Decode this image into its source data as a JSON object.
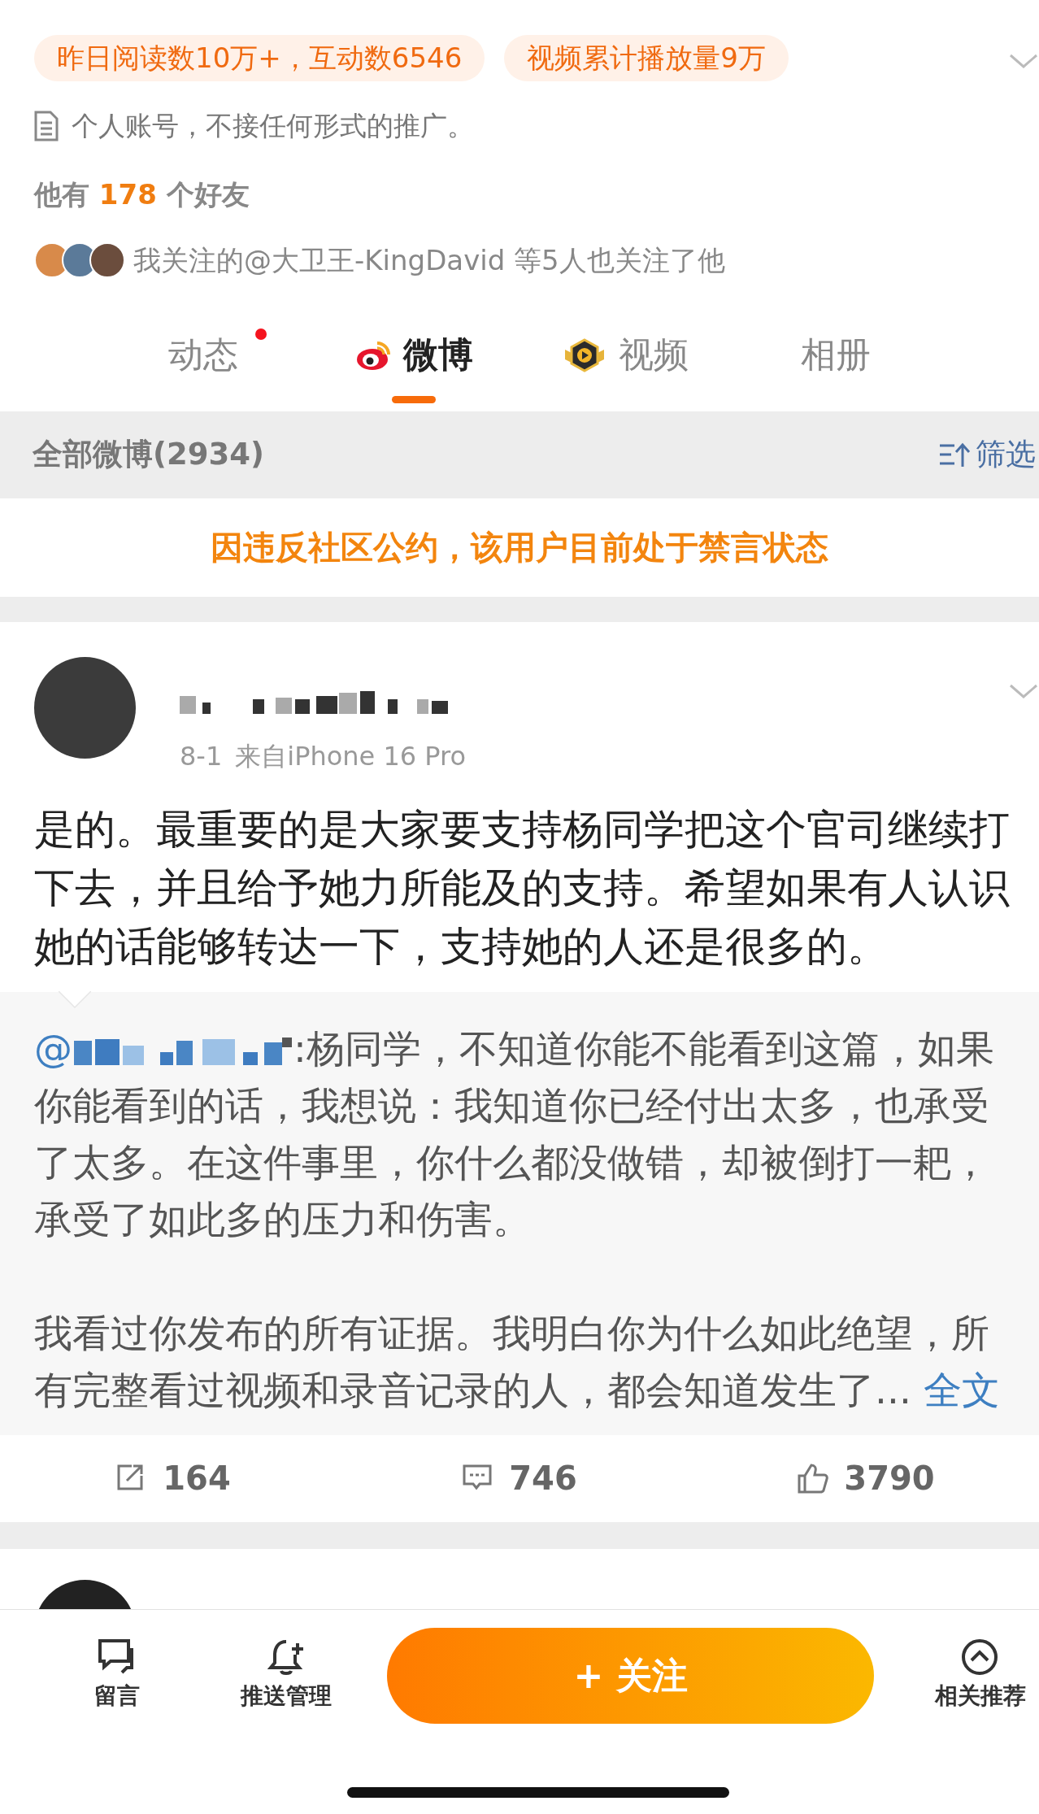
{
  "stats_chips": [
    "昨日阅读数10万+，互动数6546",
    "视频累计播放量9万"
  ],
  "bio": "个人账号，不接任何形式的推广。",
  "friends": {
    "prefix": "他有",
    "count": "178",
    "suffix": "个好友"
  },
  "mutual_follow": "我关注的@大卫王-KingDavid 等5人也关注了他",
  "tabs": [
    {
      "label": "动态",
      "selected": false,
      "unread": true,
      "kind": "plain"
    },
    {
      "label": "微博",
      "selected": true,
      "unread": false,
      "kind": "weibo"
    },
    {
      "label": "视频",
      "selected": false,
      "unread": false,
      "kind": "video"
    },
    {
      "label": "相册",
      "selected": false,
      "unread": false,
      "kind": "plain"
    }
  ],
  "feed_header": {
    "title": "全部微博(2934)",
    "filter": "筛选"
  },
  "notice": "因违反社区公约，该用户目前处于禁言状态",
  "post": {
    "date": "8-1",
    "source": "来自iPhone 16 Pro",
    "text": "是的。最重要的是大家要支持杨同学把这个官司继续打下去，并且给予她力所能及的支持。希望如果有人认识她的话能够转达一下，支持她的人还是很多的。",
    "quote": {
      "mention": "@",
      "first": ":杨同学，不知道你能不能看到这篇，如果你能看到的话，我想说：我知道你已经付出太多，也承受了太多。在这件事里，你什么都没做错，却被倒打一耙，承受了如此多的压力和伤害。",
      "second": "我看过你发布的所有证据。我明白你为什么如此绝望，所有完整看过视频和录音记录的人，都会知道发生了...",
      "more": "全文"
    },
    "actions": [
      {
        "kind": "repost",
        "count": "164"
      },
      {
        "kind": "comment",
        "count": "746"
      },
      {
        "kind": "like",
        "count": "3790"
      }
    ]
  },
  "bottom_bar": [
    {
      "kind": "message",
      "label": "留言"
    },
    {
      "kind": "bell",
      "label": "推送管理"
    },
    {
      "kind": "follow",
      "label": "+ 关注"
    },
    {
      "kind": "related",
      "label": "相关推荐"
    }
  ]
}
